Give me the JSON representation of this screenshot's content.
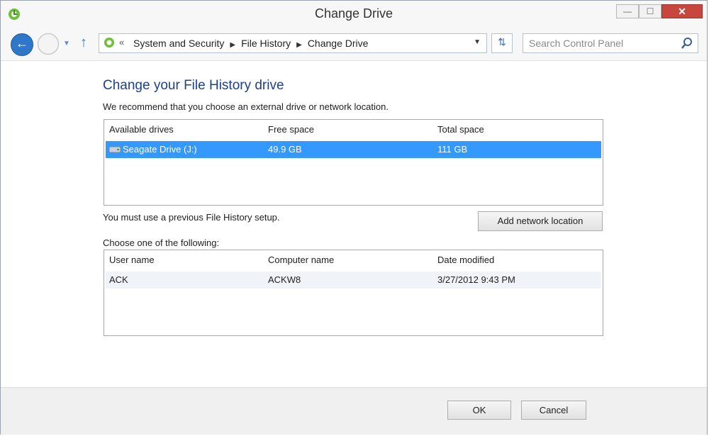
{
  "window": {
    "title": "Change Drive",
    "min_glyph": "—",
    "max_glyph": "☐",
    "close_glyph": "✕"
  },
  "nav": {
    "breadcrumbs": [
      "System and Security",
      "File History",
      "Change Drive"
    ],
    "chevrons": "«",
    "search_placeholder": "Search Control Panel"
  },
  "main": {
    "heading": "Change your File History drive",
    "recommend": "We recommend that you choose an external drive or network location.",
    "drives": {
      "columns": [
        "Available drives",
        "Free space",
        "Total space"
      ],
      "rows": [
        {
          "name": "Seagate Drive (J:)",
          "free": "49.9 GB",
          "total": "111 GB",
          "selected": true
        }
      ]
    },
    "message": "You must use a previous File History setup.",
    "add_network_label": "Add network location",
    "choose_label": "Choose one of the following:",
    "setups": {
      "columns": [
        "User name",
        "Computer name",
        "Date modified"
      ],
      "rows": [
        {
          "user": "ACK",
          "computer": "ACKW8",
          "date": "3/27/2012 9:43 PM"
        }
      ]
    }
  },
  "footer": {
    "ok_label": "OK",
    "cancel_label": "Cancel"
  },
  "colors": {
    "accent": "#3399ff",
    "heading": "#1e3f8a",
    "close": "#c7463e"
  }
}
